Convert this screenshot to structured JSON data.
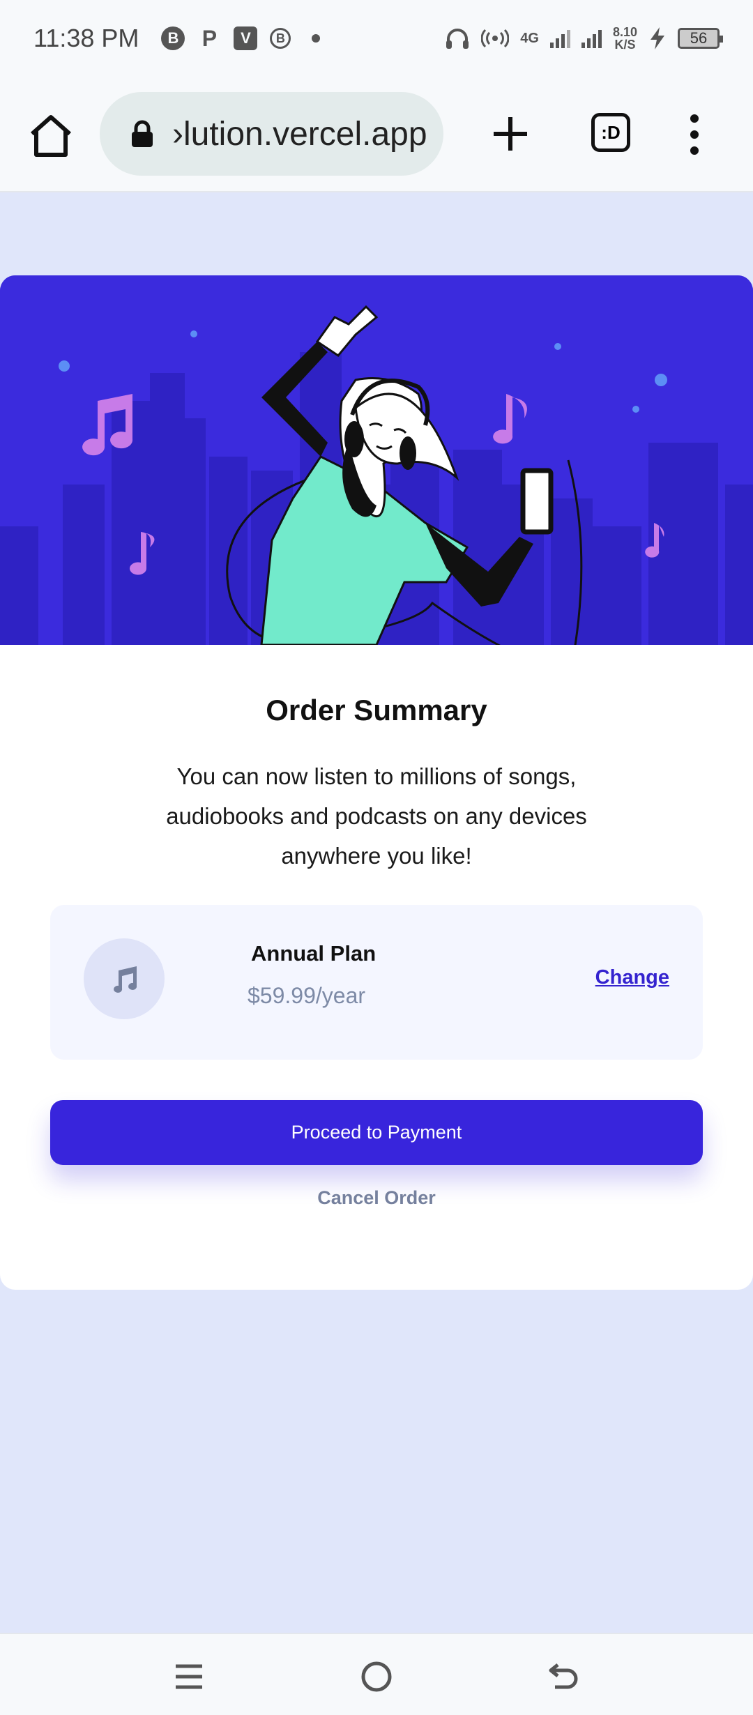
{
  "status_bar": {
    "time": "11:38 PM",
    "notification_icons": [
      "B",
      "P",
      "V",
      "B"
    ],
    "network_type": "4G",
    "net_speed_value": "8.10",
    "net_speed_unit": "K/S",
    "battery_level": "56"
  },
  "browser": {
    "url": "›lution.vercel.app",
    "tabs_label": ":D"
  },
  "order": {
    "title": "Order Summary",
    "description": "You can now listen to millions of songs, audiobooks and podcasts on any devices anywhere you like!",
    "plan_name": "Annual Plan",
    "plan_price": "$59.99/year",
    "change_label": "Change",
    "proceed_label": "Proceed to Payment",
    "cancel_label": "Cancel Order"
  },
  "colors": {
    "accent": "#3825dc",
    "hero_bg": "#3b2bdd",
    "page_bg": "#e0e6fa",
    "plan_bg": "#f4f6ff",
    "muted_text": "#7d8aa6",
    "shirt": "#72eacb",
    "notes": "#c77be8"
  },
  "icons": {
    "home": "home-icon",
    "lock": "lock-icon",
    "plus": "plus-icon",
    "menu": "kebab-menu-icon",
    "music": "music-note-icon",
    "nav_recent": "recent-apps-icon",
    "nav_home": "home-circle-icon",
    "nav_back": "back-icon"
  }
}
